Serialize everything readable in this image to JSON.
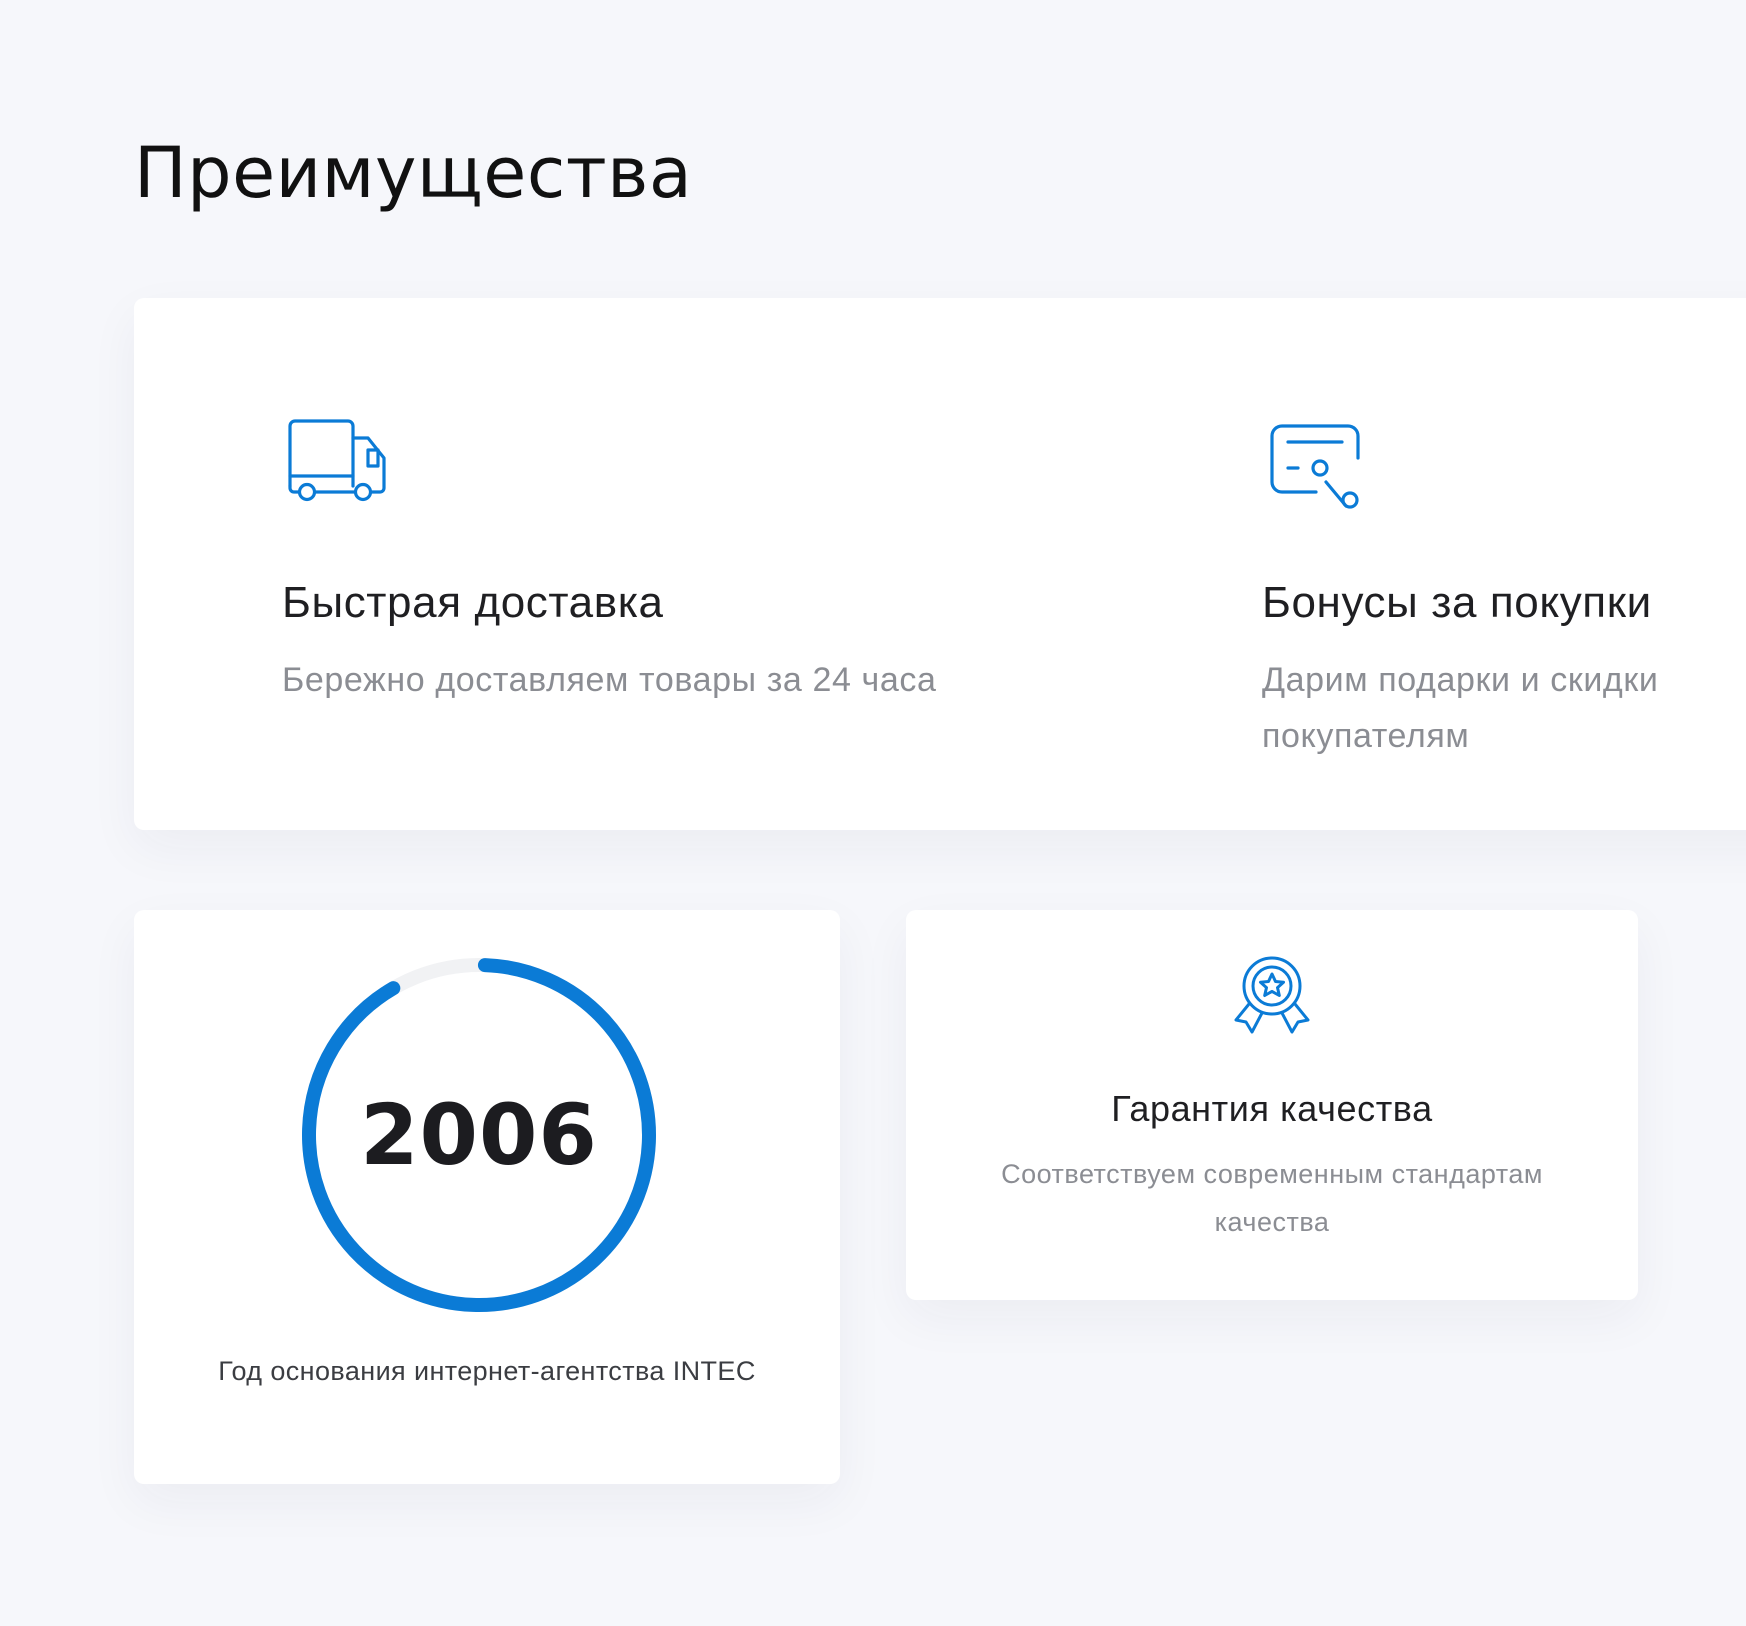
{
  "section": {
    "title": "Преимущества"
  },
  "features": [
    {
      "icon": "delivery-truck-icon",
      "title": "Быстрая доставка",
      "description": "Бережно доставляем товары за 24 часа"
    },
    {
      "icon": "discount-coupon-icon",
      "title": "Бонусы за покупки",
      "description": "Дарим подарки и скидки покупателям"
    }
  ],
  "year_card": {
    "value": "2006",
    "caption": "Год основания интернет-агентства INTEC",
    "ring_progress": 0.91
  },
  "quality_card": {
    "icon": "award-badge-icon",
    "title": "Гарантия качества",
    "description": "Соответствуем современным стандартам качества"
  },
  "colors": {
    "accent": "#0b7bd6",
    "background": "#f6f7fb",
    "card": "#ffffff",
    "title_text": "#1f1f22",
    "muted_text": "#8b8d93",
    "ring_track": "#f1f2f4"
  }
}
